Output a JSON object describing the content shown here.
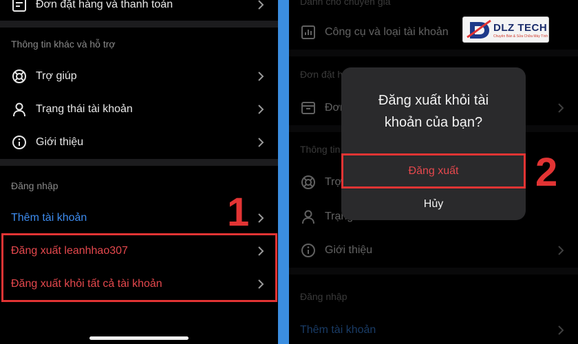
{
  "left": {
    "top_item": "Đơn đặt hàng và thanh toán",
    "support_section": "Thông tin khác và hỗ trợ",
    "support_items": [
      "Trợ giúp",
      "Trạng thái tài khoản",
      "Giới thiệu"
    ],
    "login_section": "Đăng nhập",
    "add_account": "Thêm tài khoản",
    "logout_user": "Đăng xuất leanhhao307",
    "logout_all": "Đăng xuất khỏi tất cả tài khoản",
    "step_number": "1"
  },
  "right": {
    "top_section": "Dành cho chuyên gia",
    "tools_item": "Công cụ và loại tài khoản",
    "orders_section": "Đơn đặt hàng",
    "orders_item": "Đơn",
    "other_section": "Thông tin",
    "support_item": "Trợ",
    "status_item": "Trạng",
    "about_item": "Giới thiệu",
    "login_section": "Đăng nhập",
    "add_account": "Thêm tài khoản",
    "step_number": "2"
  },
  "modal": {
    "title": "Đăng xuất khỏi tài khoản của bạn?",
    "confirm_label": "Đăng xuất",
    "cancel_label": "Hủy"
  },
  "logo": {
    "text": "DLZ TECH",
    "subtext": "Chuyên Bán & Sửa Chữa Máy Tính"
  },
  "colors": {
    "background": "#000000",
    "divider_gutter": "#3b8ee0",
    "accent_blue": "#3d8cf0",
    "danger_red": "#e5484d",
    "annotation_red": "#e23434"
  },
  "icons": [
    "document-icon",
    "lifebuoy-icon",
    "person-icon",
    "info-icon",
    "chevron-right-icon",
    "bar-chart-icon",
    "box-icon"
  ]
}
